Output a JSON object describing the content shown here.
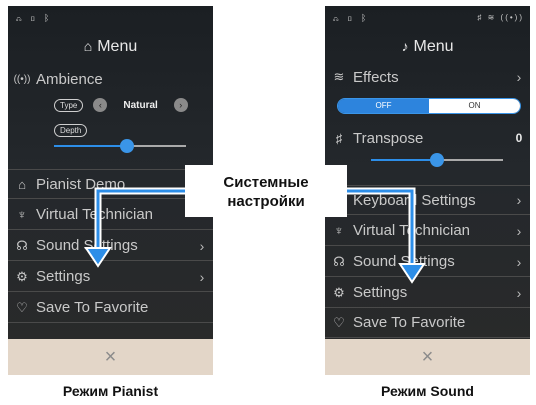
{
  "callout": {
    "line1": "Системные",
    "line2": "настройки"
  },
  "captions": {
    "left": "Режим Pianist",
    "right": "Режим Sound"
  },
  "left_panel": {
    "title": "Menu",
    "ambience": {
      "label": "Ambience",
      "type_pill": "Type",
      "type_value": "Natural",
      "depth_pill": "Depth",
      "depth_level": 0.55
    },
    "items": [
      {
        "label": "Pianist Demo",
        "icon": "piano-icon"
      },
      {
        "label": "Virtual Technician",
        "icon": "technician-icon"
      },
      {
        "label": "Sound Settings",
        "icon": "headphones-icon",
        "chevron": "›"
      },
      {
        "label": "Settings",
        "icon": "gear-icon",
        "chevron": "›"
      },
      {
        "label": "Save To Favorite",
        "icon": "heart-icon"
      }
    ],
    "close": "×"
  },
  "right_panel": {
    "title": "Menu",
    "effects": {
      "label": "Effects",
      "chevron": "›",
      "off": "OFF",
      "on": "ON"
    },
    "transpose": {
      "label": "Transpose",
      "value": "0",
      "level": 0.5
    },
    "items": [
      {
        "label": "Keyboard Settings",
        "icon": "keyboard-icon",
        "chevron": "›"
      },
      {
        "label": "Virtual Technician",
        "icon": "technician-icon",
        "chevron": "›"
      },
      {
        "label": "Sound Settings",
        "icon": "headphones-icon",
        "chevron": "›"
      },
      {
        "label": "Settings",
        "icon": "gear-icon",
        "chevron": "›"
      },
      {
        "label": "Save To Favorite",
        "icon": "heart-icon"
      }
    ],
    "close": "×"
  },
  "colors": {
    "accent": "#2d8ee8",
    "footer": "#e3d6c8",
    "panel_bg": "#1f2327"
  }
}
